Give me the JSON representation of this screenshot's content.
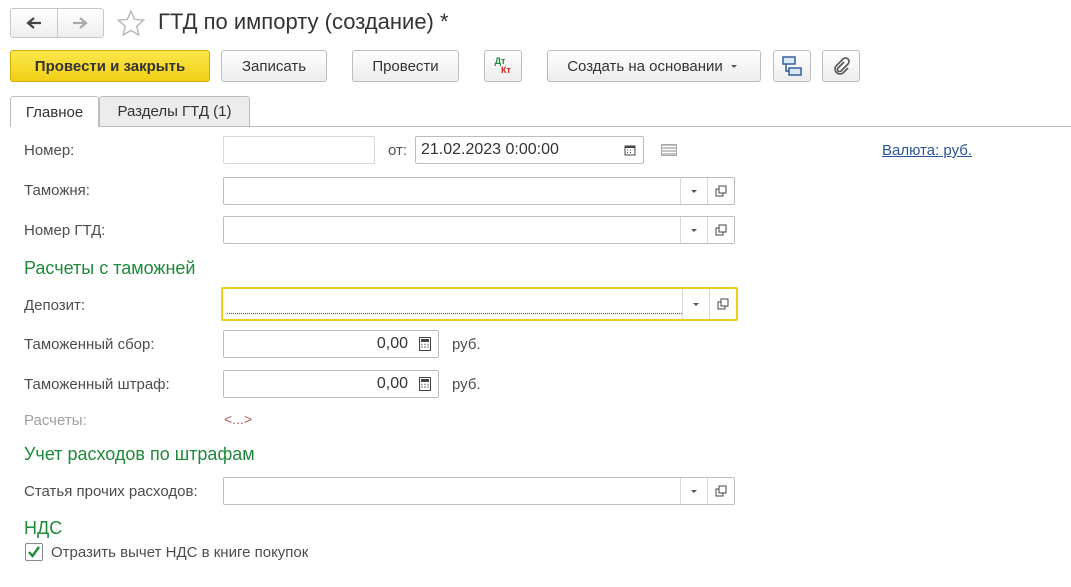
{
  "window": {
    "title": "ГТД по импорту (создание) *"
  },
  "toolbar": {
    "post_close": "Провести и закрыть",
    "save": "Записать",
    "post": "Провести",
    "dtkt_dt": "Дт",
    "dtkt_kt": "Кт",
    "create_based": "Создать на основании",
    "colors": {
      "primary": "#f2cf14",
      "dt": "#1d8a3a",
      "kt": "#d21f1f"
    }
  },
  "tabs": [
    {
      "label": "Главное",
      "active": true
    },
    {
      "label": "Разделы ГТД (1)",
      "active": false
    }
  ],
  "form": {
    "number_label": "Номер:",
    "number_value": "",
    "date_prefix": "от:",
    "date_value": "21.02.2023  0:00:00",
    "currency_link": "Валюта: руб.",
    "customs_label": "Таможня:",
    "customs_value": "",
    "gtd_number_label": "Номер ГТД:",
    "gtd_number_value": "",
    "section_customs": "Расчеты с таможней",
    "deposit_label": "Депозит:",
    "deposit_value": "",
    "fee_label": "Таможенный сбор:",
    "fee_value": "0,00",
    "fee_unit": "руб.",
    "fine_label": "Таможенный штраф:",
    "fine_value": "0,00",
    "fine_unit": "руб.",
    "settlements_label": "Расчеты:",
    "settlements_value": "<...>",
    "section_fines": "Учет расходов по штрафам",
    "other_expense_label": "Статья прочих расходов:",
    "other_expense_value": "",
    "section_vat": "НДС",
    "vat_checkbox_label": "Отразить вычет НДС в книге покупок",
    "vat_checkbox_checked": true
  }
}
